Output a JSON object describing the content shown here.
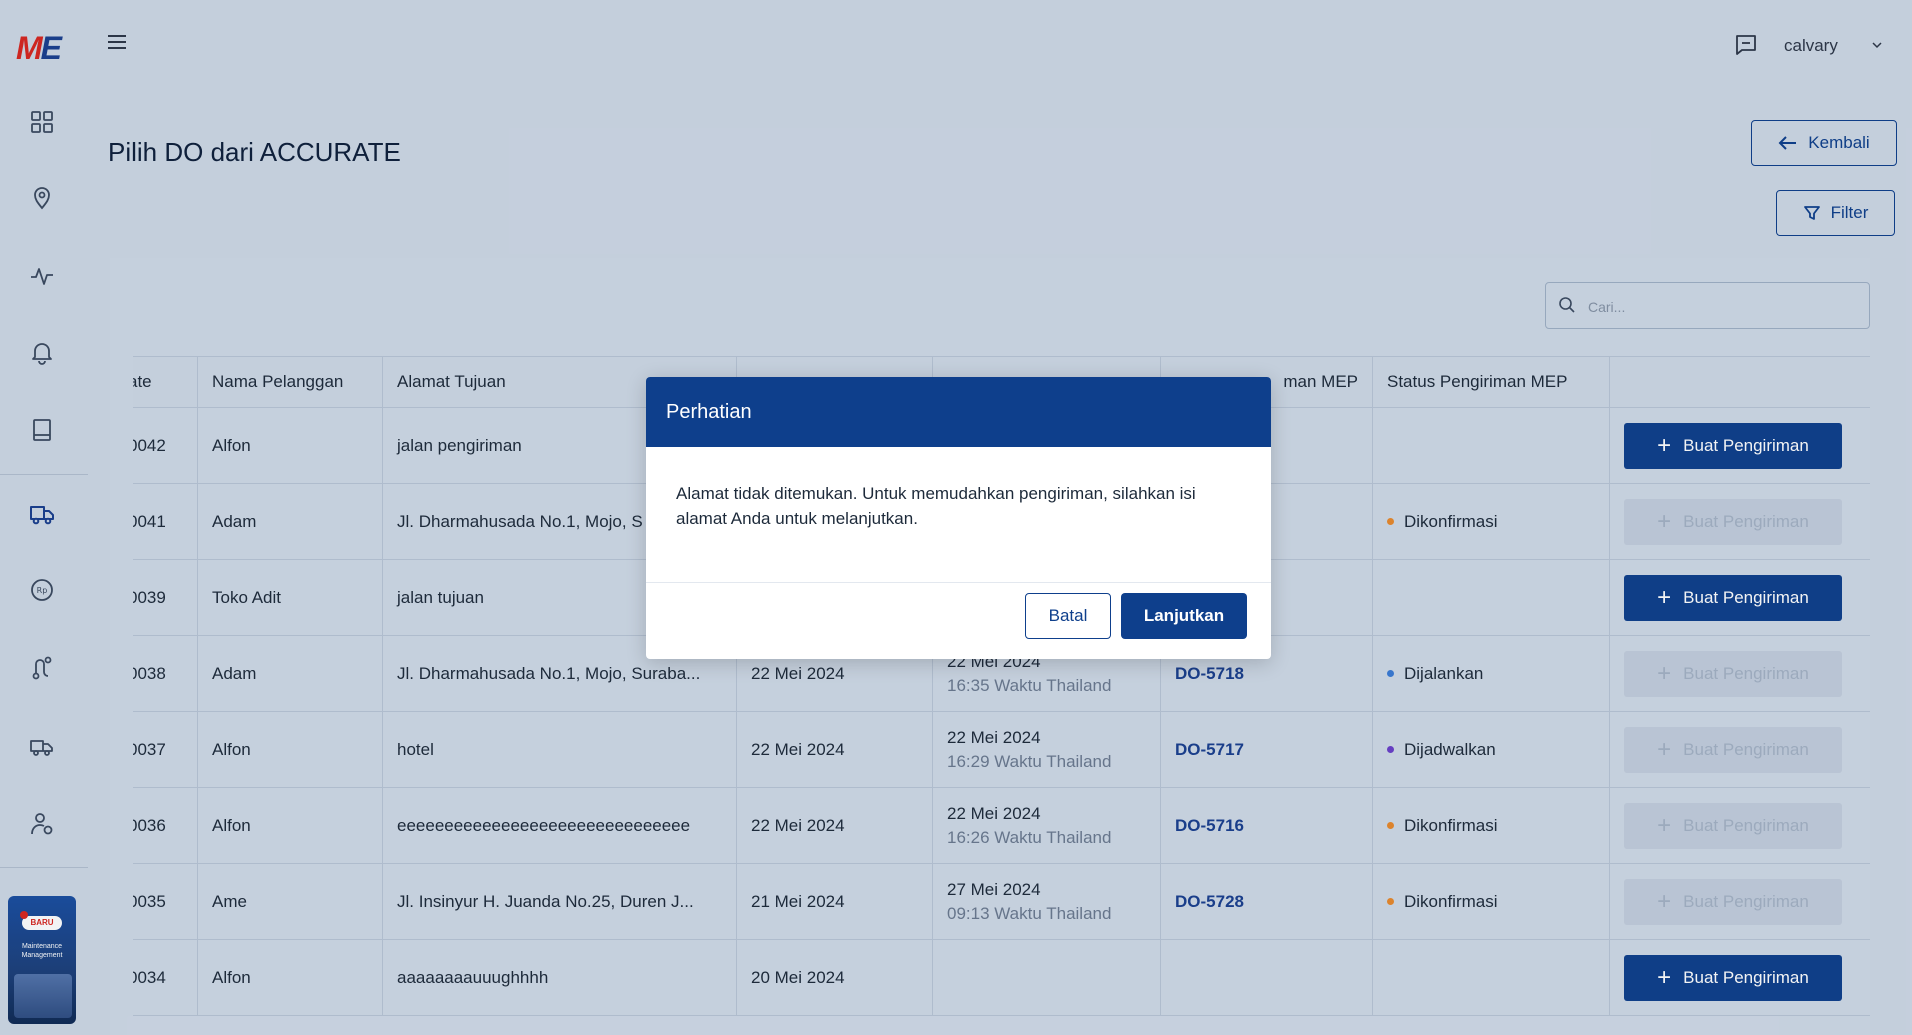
{
  "app": {
    "logo_m": "M",
    "logo_e": "E"
  },
  "header": {
    "user_name": "calvary"
  },
  "page": {
    "title": "Pilih DO dari ACCURATE",
    "back_label": "Kembali",
    "filter_label": "Filter"
  },
  "search": {
    "placeholder": "Cari..."
  },
  "promo": {
    "badge": "BARU",
    "text": "Maintenance Management"
  },
  "colors": {
    "primary": "#0e3f8c",
    "accent_red": "#d8261f",
    "status_orange": "#e8892b",
    "status_blue": "#3a7bd5",
    "status_purple": "#6a3fc9"
  },
  "table": {
    "headers": [
      "ate",
      "Nama Pelanggan",
      "Alamat Tujuan",
      "",
      "",
      "man MEP",
      "Status Pengiriman MEP",
      ""
    ],
    "rows": [
      {
        "no": "0042",
        "customer": "Alfon",
        "address": "jalan pengiriman",
        "date": "",
        "sched_date": "",
        "sched_time": "",
        "do": "",
        "status": "",
        "status_color": "",
        "action": "Buat Pengiriman",
        "enabled": true
      },
      {
        "no": "0041",
        "customer": "Adam",
        "address": "Jl. Dharmahusada No.1, Mojo, S",
        "date": "",
        "sched_date": "",
        "sched_time": "",
        "do": "",
        "status": "Dikonfirmasi",
        "status_color": "#e8892b",
        "action": "Buat Pengiriman",
        "enabled": false
      },
      {
        "no": "0039",
        "customer": "Toko Adit",
        "address": "jalan tujuan",
        "date": "",
        "sched_date": "",
        "sched_time": "",
        "do": "",
        "status": "",
        "status_color": "",
        "action": "Buat Pengiriman",
        "enabled": true
      },
      {
        "no": "0038",
        "customer": "Adam",
        "address": "Jl. Dharmahusada No.1, Mojo, Suraba...",
        "date": "22 Mei 2024",
        "sched_date": "22 Mei 2024",
        "sched_time": "16:35 Waktu Thailand",
        "do": "DO-5718",
        "status": "Dijalankan",
        "status_color": "#3a7bd5",
        "action": "Buat Pengiriman",
        "enabled": false
      },
      {
        "no": "0037",
        "customer": "Alfon",
        "address": "hotel",
        "date": "22 Mei 2024",
        "sched_date": "22 Mei 2024",
        "sched_time": "16:29 Waktu Thailand",
        "do": "DO-5717",
        "status": "Dijadwalkan",
        "status_color": "#6a3fc9",
        "action": "Buat Pengiriman",
        "enabled": false
      },
      {
        "no": "0036",
        "customer": "Alfon",
        "address": "eeeeeeeeeeeeeeeeeeeeeeeeeeeeeee",
        "date": "22 Mei 2024",
        "sched_date": "22 Mei 2024",
        "sched_time": "16:26 Waktu Thailand",
        "do": "DO-5716",
        "status": "Dikonfirmasi",
        "status_color": "#e8892b",
        "action": "Buat Pengiriman",
        "enabled": false
      },
      {
        "no": "0035",
        "customer": "Ame",
        "address": "Jl. Insinyur H. Juanda No.25, Duren J...",
        "date": "21 Mei 2024",
        "sched_date": "27 Mei 2024",
        "sched_time": "09:13 Waktu Thailand",
        "do": "DO-5728",
        "status": "Dikonfirmasi",
        "status_color": "#e8892b",
        "action": "Buat Pengiriman",
        "enabled": false
      },
      {
        "no": "0034",
        "customer": "Alfon",
        "address": "aaaaaaaauuughhhh",
        "date": "20 Mei 2024",
        "sched_date": "",
        "sched_time": "",
        "do": "",
        "status": "",
        "status_color": "",
        "action": "Buat Pengiriman",
        "enabled": true
      }
    ]
  },
  "modal": {
    "title": "Perhatian",
    "message": "Alamat tidak ditemukan. Untuk memudahkan pengiriman, silahkan isi alamat Anda untuk melanjutkan.",
    "cancel_label": "Batal",
    "confirm_label": "Lanjutkan"
  },
  "sidebar_icons": [
    "dashboard-icon",
    "location-icon",
    "activity-icon",
    "bell-icon",
    "book-icon",
    "truck-icon",
    "payment-icon",
    "route-icon",
    "fleet-icon",
    "user-settings-icon"
  ]
}
